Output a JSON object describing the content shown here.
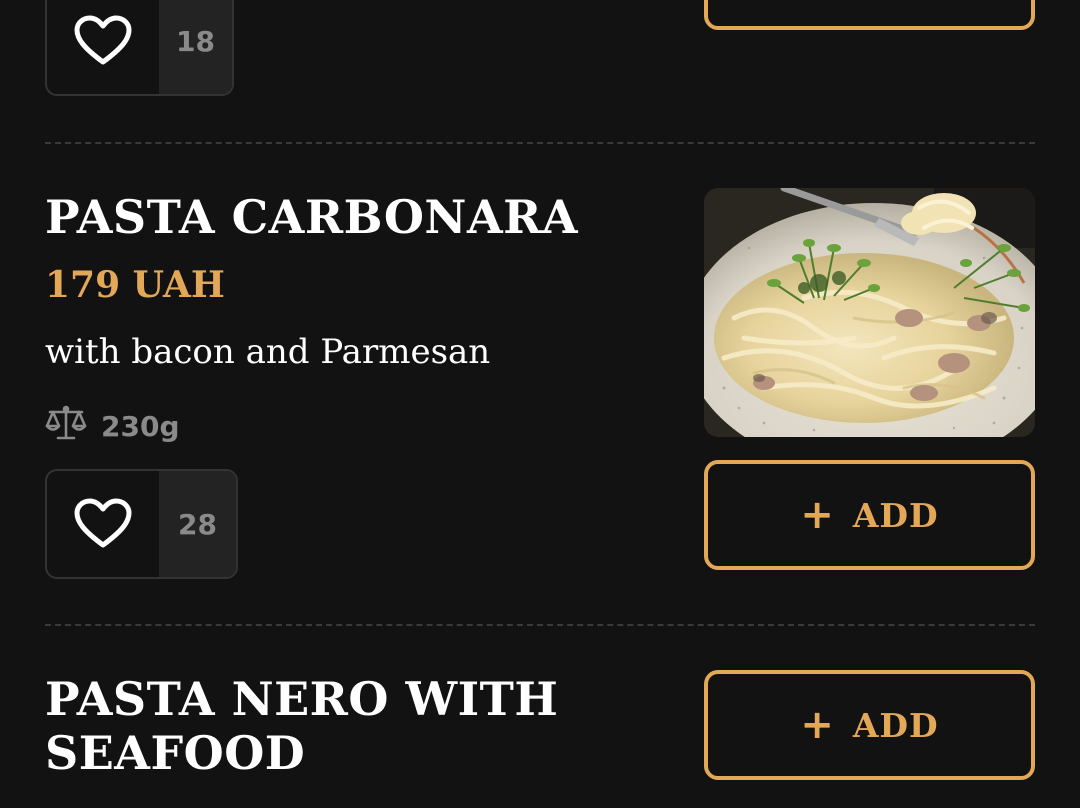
{
  "colors": {
    "background": "#121212",
    "accent": "#e3a857",
    "muted_text": "#8a8a8a",
    "panel": "#232323"
  },
  "items": [
    {
      "likes": "18",
      "heart_icon": "heart-outline-icon"
    },
    {
      "title": "PASTA CARBONARA",
      "price": "179 UAH",
      "description": "with bacon and Parmesan",
      "weight": "230g",
      "weight_icon": "scale-icon",
      "likes": "28",
      "heart_icon": "heart-outline-icon",
      "add_label": "ADD",
      "plus_icon": "+"
    },
    {
      "title_line1": "PASTA NERO WITH",
      "title_line2": "SEAFOOD",
      "add_label": "ADD",
      "plus_icon": "+"
    }
  ]
}
